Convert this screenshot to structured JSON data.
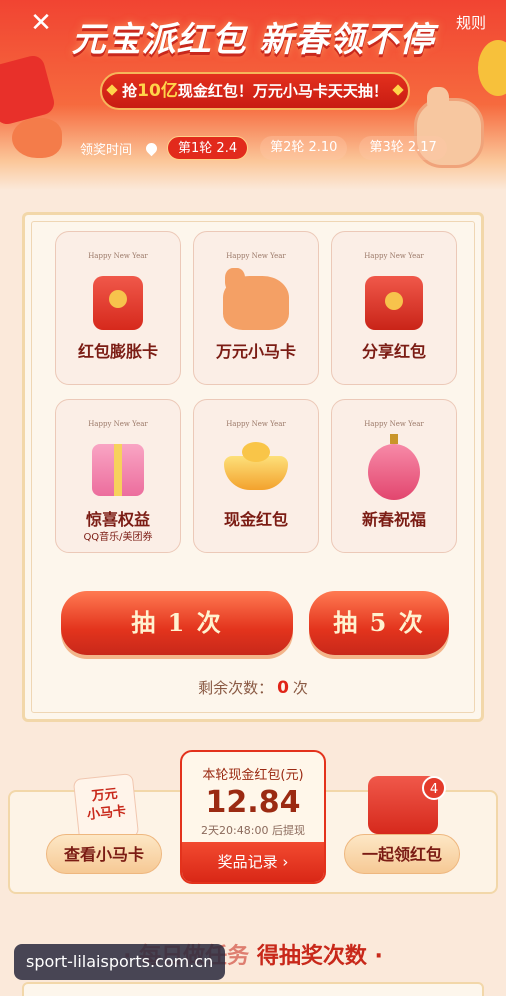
{
  "header": {
    "close_icon": "close-icon",
    "rules": "规则",
    "title": "元宝派红包 新春领不停",
    "banner_pre": "抢",
    "banner_hl": "10亿",
    "banner_post": "现金红包！万元小马卡天天抽！",
    "schedule_label": "领奖时间",
    "rounds": [
      {
        "label": "第1轮 2.4",
        "active": true
      },
      {
        "label": "第2轮 2.10",
        "active": false
      },
      {
        "label": "第3轮 2.17",
        "active": false
      }
    ]
  },
  "prizes": [
    {
      "hny": "Happy New Year",
      "label": "红包膨胀卡",
      "sub": "",
      "icon": "red-envelope-icon"
    },
    {
      "hny": "Happy New Year",
      "label": "万元小马卡",
      "sub": "",
      "icon": "horse-icon"
    },
    {
      "hny": "Happy New Year",
      "label": "分享红包",
      "sub": "",
      "icon": "red-envelopes-icon"
    },
    {
      "hny": "Happy New Year",
      "label": "惊喜权益",
      "sub": "QQ音乐/美团券",
      "icon": "gift-box-icon"
    },
    {
      "hny": "Happy New Year",
      "label": "现金红包",
      "sub": "",
      "icon": "gold-ingot-icon"
    },
    {
      "hny": "Happy New Year",
      "label": "新春祝福",
      "sub": "",
      "icon": "lantern-icon"
    }
  ],
  "draw": {
    "draw1": "抽 1 次",
    "draw5": "抽 5 次",
    "remain_label": "剩余次数：",
    "remain_count": "0",
    "remain_unit": "次"
  },
  "bottom": {
    "card_text_1": "万元",
    "card_text_2": "小马卡",
    "view_card": "查看小马卡",
    "cash_title": "本轮现金红包(元)",
    "cash_amount": "12.84",
    "cash_note": "2天20:48:00 后提现",
    "records": "奖品记录 ›",
    "collect": "一起领红包",
    "badge": "4"
  },
  "section_title_a": "· 每日做任务",
  "section_title_b": "得抽奖次数 ·",
  "watermark": "sport-lilaisports.com.cn"
}
